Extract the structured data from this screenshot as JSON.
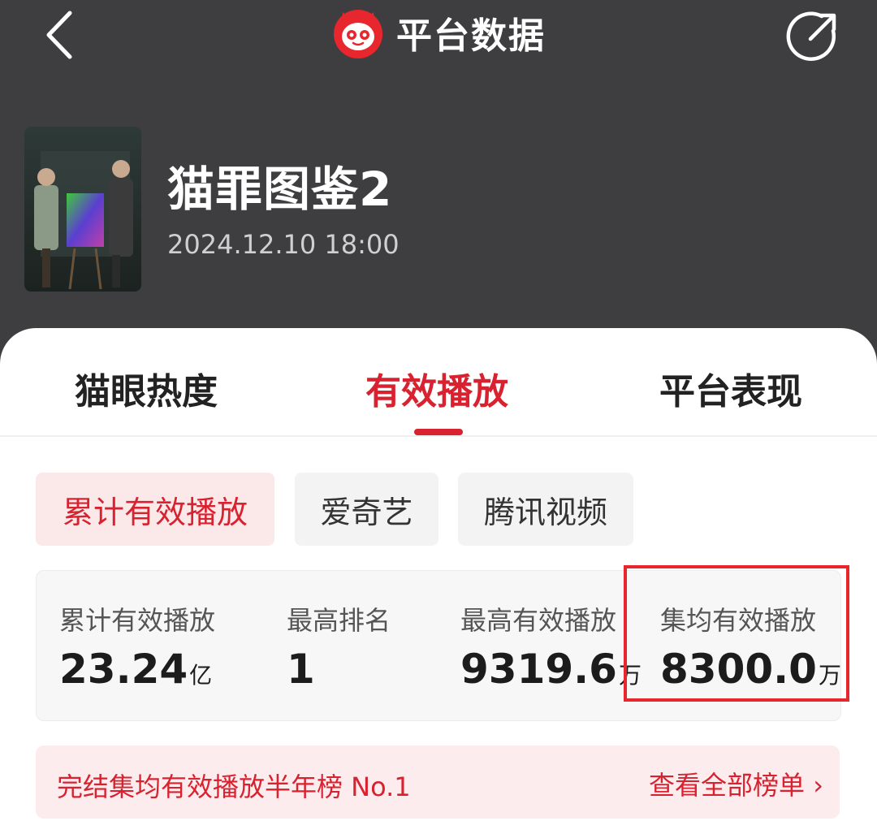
{
  "header": {
    "title": "平台数据",
    "show_name": "猫罪图鉴2",
    "air_time": "2024.12.10 18:00"
  },
  "tabs": [
    {
      "label": "猫眼热度",
      "active": false
    },
    {
      "label": "有效播放",
      "active": true
    },
    {
      "label": "平台表现",
      "active": false
    }
  ],
  "filters": [
    {
      "label": "累计有效播放",
      "active": true
    },
    {
      "label": "爱奇艺",
      "active": false
    },
    {
      "label": "腾讯视频",
      "active": false
    }
  ],
  "stats": [
    {
      "label": "累计有效播放",
      "value": "23.24",
      "unit": "亿"
    },
    {
      "label": "最高排名",
      "value": "1",
      "unit": ""
    },
    {
      "label": "最高有效播放",
      "value": "9319.6",
      "unit": "万"
    },
    {
      "label": "集均有效播放",
      "value": "8300.0",
      "unit": "万"
    }
  ],
  "ranking": {
    "text": "完结集均有效播放半年榜 No.1",
    "link": "查看全部榜单 ›"
  },
  "colors": {
    "accent": "#d8222f",
    "header_bg": "#3e3e40",
    "highlight": "#e8262e"
  },
  "icons": [
    "back-icon",
    "maoyan-cat-logo-icon",
    "share-icon"
  ]
}
